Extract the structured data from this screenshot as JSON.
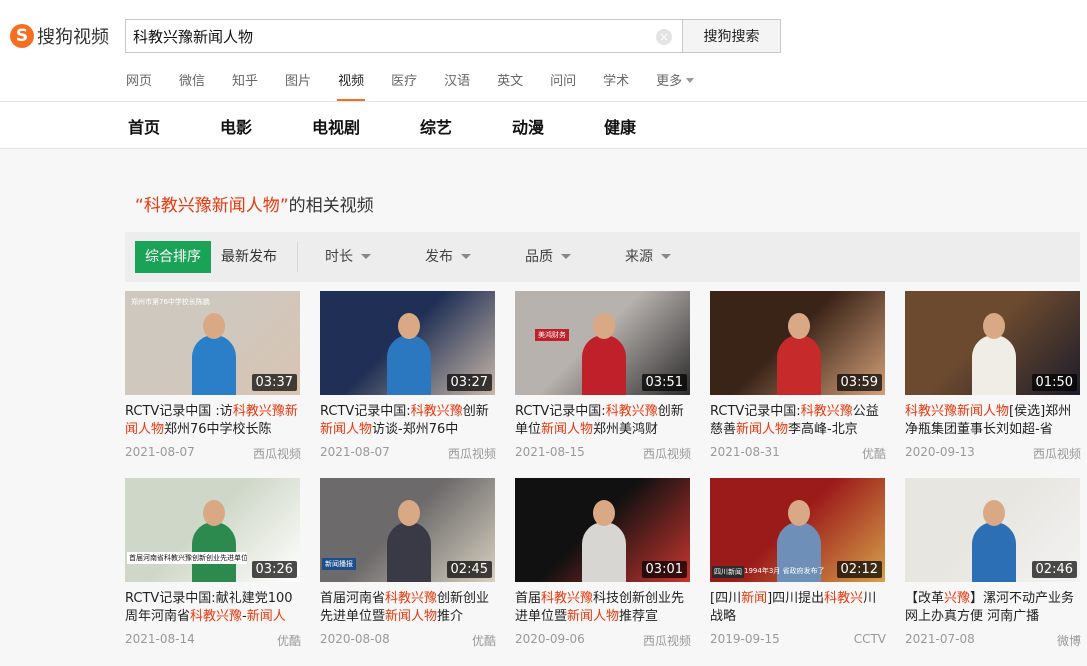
{
  "logo": {
    "mark": "S",
    "text": "搜狗视频"
  },
  "search": {
    "value": "科教兴豫新闻人物",
    "button_label": "搜狗搜索",
    "clear_glyph": "×"
  },
  "channels": [
    "网页",
    "微信",
    "知乎",
    "图片",
    "视频",
    "医疗",
    "汉语",
    "英文",
    "问问",
    "学术",
    "更多"
  ],
  "active_channel": "视频",
  "categories": [
    "首页",
    "电影",
    "电视剧",
    "综艺",
    "动漫",
    "健康"
  ],
  "related": {
    "open_quote": "“",
    "keyword": "科教兴豫新闻人物",
    "close_quote": "”",
    "suffix": "的相关视频"
  },
  "filters": {
    "sort_active": "综合排序",
    "sort_new": "最新发布",
    "dropdowns": [
      "时长",
      "发布",
      "品质",
      "来源"
    ]
  },
  "videos": [
    {
      "duration": "03:37",
      "title": [
        [
          "RCTV记录中国 :访",
          ""
        ],
        [
          "科教兴豫",
          "hl"
        ],
        [
          "新闻人物",
          "hl"
        ],
        [
          "郑州76中学校长陈",
          ""
        ]
      ],
      "date": "2021-08-07",
      "source": "西瓜视频",
      "palette": [
        "#cfc8bf",
        "#2a7fc8",
        "#d8c4b0"
      ]
    },
    {
      "duration": "03:27",
      "title": [
        [
          "RCTV记录中国:",
          ""
        ],
        [
          "科教兴豫",
          "hl"
        ],
        [
          "创新",
          ""
        ],
        [
          "新闻人物",
          "hl"
        ],
        [
          "访谈-郑州76中",
          ""
        ]
      ],
      "date": "2021-08-07",
      "source": "西瓜视频",
      "palette": [
        "#1f2f55",
        "#2b77c0",
        "#c9b8a8"
      ]
    },
    {
      "duration": "03:51",
      "title": [
        [
          "RCTV记录中国:",
          ""
        ],
        [
          "科教兴豫",
          "hl"
        ],
        [
          "创",
          ""
        ],
        [
          "新单位",
          ""
        ],
        [
          "新闻人物",
          "hl"
        ],
        [
          "郑州美鸿财",
          ""
        ]
      ],
      "date": "2021-08-15",
      "source": "西瓜视频",
      "palette": [
        "#b8b2ae",
        "#c0202a",
        "#2b2b2b"
      ]
    },
    {
      "duration": "03:59",
      "title": [
        [
          "RCTV记录中国:",
          ""
        ],
        [
          "科教兴豫",
          "hl"
        ],
        [
          "公",
          ""
        ],
        [
          "益慈善",
          ""
        ],
        [
          "新闻人物",
          "hl"
        ],
        [
          "李高峰-北京",
          ""
        ]
      ],
      "date": "2021-08-31",
      "source": "优酷",
      "palette": [
        "#3a2418",
        "#c62a2a",
        "#d4a07a"
      ]
    },
    {
      "duration": "01:50",
      "title": [
        [
          "科教兴豫",
          "hl"
        ],
        [
          "新闻人物",
          "hl"
        ],
        [
          "[侯选]郑",
          ""
        ],
        [
          "州净瓶集团董事长刘如超-省",
          ""
        ]
      ],
      "date": "2020-09-13",
      "source": "西瓜视频",
      "palette": [
        "#6b4a2f",
        "#f0ece6",
        "#1c1c2a"
      ]
    },
    {
      "duration": "03:26",
      "title": [
        [
          "RCTV记录中国:",
          ""
        ],
        [
          "献礼建党100",
          ""
        ],
        [
          "周年河南省",
          ""
        ],
        [
          "科教兴豫",
          "hl"
        ],
        [
          "-",
          ""
        ],
        [
          "新闻人",
          "hl"
        ]
      ],
      "date": "2021-08-14",
      "source": "优酷",
      "palette": [
        "#cfd8c8",
        "#2d8a4e",
        "#ffffff"
      ]
    },
    {
      "duration": "02:45",
      "title": [
        [
          "首届河南省",
          ""
        ],
        [
          "科教兴豫",
          "hl"
        ],
        [
          "创新创",
          ""
        ],
        [
          "业先进单位暨",
          ""
        ],
        [
          "新闻人物",
          "hl"
        ],
        [
          "推介",
          ""
        ]
      ],
      "date": "2020-08-08",
      "source": "优酷",
      "palette": [
        "#6c6a6a",
        "#3a3a46",
        "#d8d0c0"
      ]
    },
    {
      "duration": "03:01",
      "title": [
        [
          "首届",
          ""
        ],
        [
          "科教兴豫",
          "hl"
        ],
        [
          "科技创新创业",
          ""
        ],
        [
          "先进单位暨",
          ""
        ],
        [
          "新闻人物",
          "hl"
        ],
        [
          "推荐宣",
          ""
        ]
      ],
      "date": "2020-09-06",
      "source": "西瓜视频",
      "palette": [
        "#111111",
        "#d8d6d2",
        "#c9352e"
      ]
    },
    {
      "duration": "02:12",
      "title": [
        [
          "[四川",
          ""
        ],
        [
          "新闻",
          "hl"
        ],
        [
          "]四川提出",
          ""
        ],
        [
          "科教兴",
          "hl"
        ],
        [
          "川战略",
          ""
        ]
      ],
      "date": "2019-09-15",
      "source": "CCTV",
      "palette": [
        "#9b1a1a",
        "#6d8fb8",
        "#d6a24a"
      ]
    },
    {
      "duration": "02:46",
      "title": [
        [
          "【改革",
          ""
        ],
        [
          "兴豫",
          "hl"
        ],
        [
          "】漯河不动产业",
          ""
        ],
        [
          "务 网上办真方便 河南广播",
          ""
        ]
      ],
      "date": "2021-07-08",
      "source": "微博",
      "palette": [
        "#e8e6e0",
        "#2d6fb5",
        "#f2f2f2"
      ]
    }
  ],
  "overlay_texts": {
    "v1": "郑州市第76中学校长陈鹏",
    "v2": "美鸿财务",
    "v6": "首届河南省科教兴豫创新创业先进单位暨新闻人物推介",
    "v7": "新闻播报",
    "v9_tag": "四川新闻",
    "v9_note": "1994年3月 省政府发布了"
  },
  "colors": {
    "accent": "#f46f22",
    "highlight": "#e8380d",
    "sort_active": "#1aa357"
  }
}
